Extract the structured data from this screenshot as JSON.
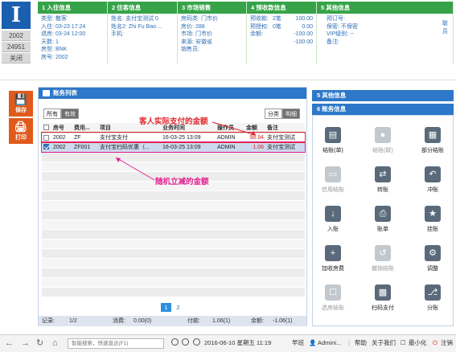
{
  "app": {
    "logo_letter": "I",
    "left_tabs": [
      "2002",
      "24951",
      "关闭"
    ],
    "action_buttons": [
      {
        "icon": "save-icon",
        "label": "保存"
      },
      {
        "icon": "print-icon",
        "label": "打印"
      }
    ]
  },
  "panels": {
    "checkin": {
      "title": "1 入住信息",
      "rows": [
        {
          "label": "类型:",
          "value": "散客"
        },
        {
          "label": "入住:",
          "value": "03-23 17:24"
        },
        {
          "label": "退房:",
          "value": "03-24 12:00"
        },
        {
          "label": "天数:",
          "value": "1"
        },
        {
          "label": "房型:",
          "value": "BNK"
        },
        {
          "label": "房号:",
          "value": "2002"
        }
      ]
    },
    "guest": {
      "title": "2 住客信息",
      "rows": [
        {
          "label": "姓名:",
          "value": "支付宝测试 0"
        },
        {
          "label": "姓名2:",
          "value": "Zhi Fu Bao ..."
        },
        {
          "label": "手机:",
          "value": ""
        }
      ]
    },
    "market": {
      "title": "3 市场销售",
      "rows": [
        {
          "label": "房码类:",
          "value": "门市价"
        },
        {
          "label": "房价:",
          "value": "288"
        },
        {
          "label": "市场:",
          "value": "门市价"
        },
        {
          "label": "来源:",
          "value": "安徽省"
        },
        {
          "label": "销售员:",
          "value": ""
        }
      ]
    },
    "prepay": {
      "title": "4 预收款信息",
      "rows": [
        {
          "label": "预收款:",
          "count": "2笔",
          "amount": "100.00"
        },
        {
          "label": "预授权:",
          "count": "0笔",
          "amount": "0.00"
        },
        {
          "label": "余额:",
          "count": "",
          "amount": "-100.00"
        },
        {
          "label": "",
          "count": "",
          "amount": "-100.00"
        }
      ]
    },
    "other": {
      "title": "5 其他信息",
      "rows": [
        {
          "label": "预订号:",
          "value": ""
        },
        {
          "label": "保密:",
          "value": "不保密"
        },
        {
          "label": "VIP级别:",
          "value": "--"
        },
        {
          "label": "备注:",
          "value": ""
        }
      ],
      "side": "联员"
    }
  },
  "account_list": {
    "title": "账务列表",
    "filter_tabs": [
      "所有",
      "有效"
    ],
    "view_tabs": [
      "分类",
      "明细"
    ],
    "columns": [
      "房号",
      "费用...",
      "项目",
      "业务时间",
      "操作员",
      "金额",
      "备注"
    ],
    "rows": [
      {
        "room": "2002",
        "code": "ZF",
        "item": "支付宝支付",
        "time": "16-03-25 13:09",
        "operator": "ADMIN",
        "amount": "98.94",
        "note": "支付宝测试",
        "checked": false
      },
      {
        "room": "2002",
        "code": "ZF001",
        "item": "支付宝扫码优惠（...",
        "time": "16-03-25 13:09",
        "operator": "ADMIN",
        "amount": "1.06",
        "note": "支付宝测试",
        "checked": true
      }
    ],
    "pages": [
      "1",
      "2"
    ],
    "footer": {
      "records_label": "记录:",
      "records": "1/2",
      "consume_label": "消费:",
      "consume": "0.00(0)",
      "pay_label": "付款:",
      "pay": "1.06(1)",
      "balance_label": "余额:",
      "balance": "-1.06(1)"
    }
  },
  "annotations": {
    "actual_amount": "客人实际支付的金额",
    "random_discount": "随机立减的金额"
  },
  "right_panel": {
    "other_title": "5 其他信息",
    "account_title": "6 账务信息",
    "functions": [
      {
        "label": "结账(单)",
        "icon": "receipt-icon",
        "enabled": true
      },
      {
        "label": "结账(联)",
        "icon": "coins-icon",
        "enabled": false
      },
      {
        "label": "部分结账",
        "icon": "coin-stack-icon",
        "enabled": true
      },
      {
        "label": "信用结账",
        "icon": "card-icon",
        "enabled": false
      },
      {
        "label": "转账",
        "icon": "transfer-icon",
        "enabled": true
      },
      {
        "label": "冲账",
        "icon": "reverse-icon",
        "enabled": true
      },
      {
        "label": "入账",
        "icon": "deposit-icon",
        "enabled": true
      },
      {
        "label": "账单",
        "icon": "printer-icon",
        "enabled": true
      },
      {
        "label": "挂账",
        "icon": "hang-icon",
        "enabled": true
      },
      {
        "label": "加收房费",
        "icon": "add-fee-icon",
        "enabled": true
      },
      {
        "label": "撤销结账",
        "icon": "undo-icon",
        "enabled": false
      },
      {
        "label": "调整",
        "icon": "adjust-icon",
        "enabled": true
      },
      {
        "label": "选房结账",
        "icon": "room-select-icon",
        "enabled": false
      },
      {
        "label": "扫码支付",
        "icon": "qr-icon",
        "enabled": true
      },
      {
        "label": "分账",
        "icon": "split-icon",
        "enabled": true
      }
    ]
  },
  "statusbar": {
    "search_placeholder": "智能搜索，快速直达(F1)",
    "datetime": "2016-06-10 星期五 11:19",
    "shift": "早班",
    "user": "Admini...",
    "help": "帮助",
    "about": "关于我们",
    "minimize": "最小化",
    "logout": "注销"
  }
}
